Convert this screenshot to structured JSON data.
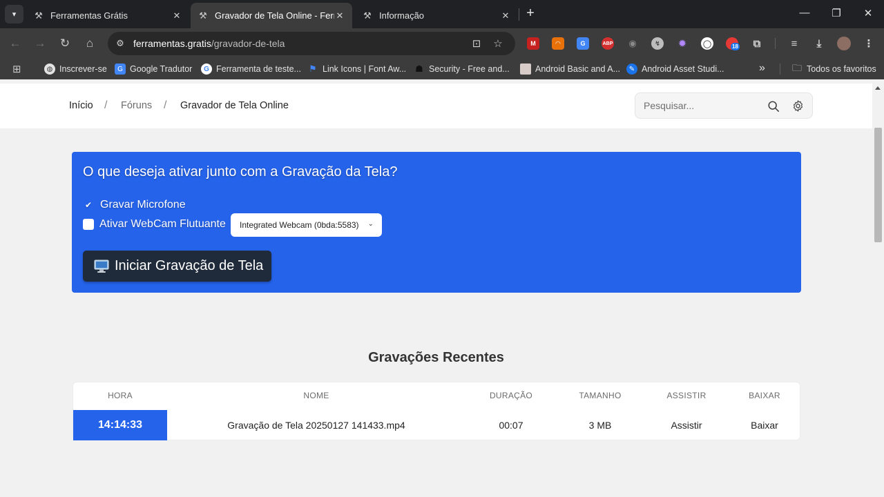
{
  "browser": {
    "tabs": [
      {
        "title": "Ferramentas Grátis",
        "close": "✕"
      },
      {
        "title": "Gravador de Tela Online - Ferramentas Grátis",
        "close": "✕"
      },
      {
        "title": "Informação",
        "close": "✕"
      }
    ],
    "new_tab": "+",
    "url_host": "ferramentas.gratis",
    "url_path": "/gravador-de-tela",
    "extension_badge": "18",
    "abp_label": "ABP",
    "bookmarks": [
      "Inscrever-se",
      "Google Tradutor",
      "Ferramenta de teste...",
      "Link Icons | Font Aw...",
      "Security - Free and...",
      "Android Basic and A...",
      "Android Asset Studi..."
    ],
    "bookmarks_overflow": "»",
    "all_bookmarks": "Todos os favoritos"
  },
  "breadcrumb": {
    "home": "Início",
    "forums": "Fóruns",
    "current": "Gravador de Tela Online",
    "separator": "/"
  },
  "search": {
    "placeholder": "Pesquisar..."
  },
  "panel": {
    "title": "O que deseja ativar junto com a Gravação da Tela?",
    "option_mic": "Gravar Microfone",
    "option_mic_checked": true,
    "option_webcam": "Ativar WebCam Flutuante",
    "option_webcam_checked": false,
    "webcam_selected": "Integrated Webcam (0bda:5583)",
    "start_button": "Iniciar Gravação de Tela"
  },
  "recent": {
    "title": "Gravações Recentes",
    "columns": [
      "HORA",
      "NOME",
      "DURAÇÃO",
      "TAMANHO",
      "ASSISTIR",
      "BAIXAR"
    ],
    "rows": [
      {
        "time": "14:14:33",
        "name": "Gravação de Tela 20250127 141433.mp4",
        "duration": "00:07",
        "size": "3 MB",
        "watch": "Assistir",
        "download": "Baixar"
      }
    ]
  },
  "colors": {
    "accent": "#2563eb",
    "button_dark": "#1f2a3a",
    "chrome_dark": "#202124",
    "toolbar": "#3c3c3c"
  },
  "icons": {
    "tab_favicon": "tools-icon",
    "mic_check": "checkmark-icon",
    "start_button": "monitor-icon",
    "search": "search-icon",
    "settings": "gear-icon"
  }
}
